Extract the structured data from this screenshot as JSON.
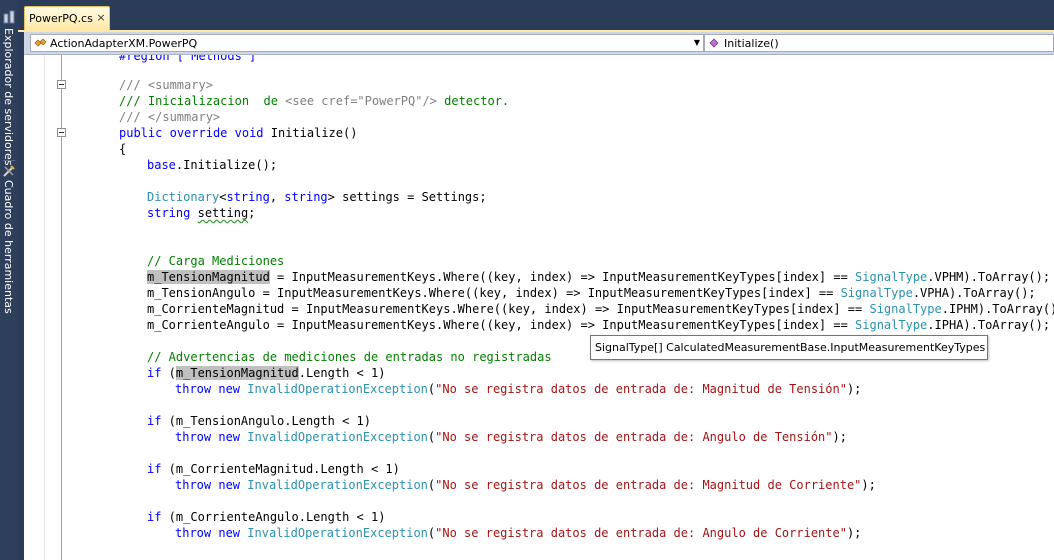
{
  "dock": {
    "items": [
      {
        "label": "Explorador de servidores",
        "icon": "server-explorer-icon"
      },
      {
        "label": "Cuadro de herramientas",
        "icon": "toolbox-icon"
      }
    ]
  },
  "tab": {
    "label": "PowerPQ.cs",
    "close": "×"
  },
  "navbar": {
    "class_combo": {
      "text": "ActionAdapterXM.PowerPQ",
      "icon": "class-icon",
      "arrow": "▼"
    },
    "member_combo": {
      "text": "Initialize()",
      "icon": "method-icon",
      "arrow": "▼"
    }
  },
  "code": {
    "partial_top": "#region [ Methods ]",
    "summary_open": "/// <summary>",
    "summary_doc_a": "/// Inicializacion  de ",
    "summary_doc_see": "<see cref=\"PowerPQ\"/>",
    "summary_doc_b": " detector.",
    "summary_close": "/// </summary>",
    "sig_public": "public",
    "sig_override": "override",
    "sig_void": "void",
    "sig_name": " Initialize()",
    "brace_open": "{",
    "base_kw": "base",
    "base_call": ".Initialize();",
    "dict_type": "Dictionary",
    "dict_lt": "<",
    "dict_string1": "string",
    "dict_comma": ", ",
    "dict_string2": "string",
    "dict_rest": "> settings = Settings;",
    "setting_kw": "string",
    "setting_var": "setting",
    "setting_semi": ";",
    "comment_carga": "// Carga Mediciones",
    "l1_var": "m_TensionMagnitud",
    "l1_mid": " = InputMeasurementKeys.Where((key, index) => InputMeasurementKeyTypes[index] == ",
    "l1_type": "SignalType",
    "l1_end": ".VPHM).ToArray();",
    "l2_var": "m_TensionAngulo",
    "l2_mid": " = InputMeasurementKeys.Where((key, index) => InputMeasurementKeyTypes[index] == ",
    "l2_type": "SignalType",
    "l2_end": ".VPHA).ToArray();",
    "l3_var": "m_CorrienteMagnitud",
    "l3_mid": " = InputMeasurementKeys.Where((key, index) => InputMeasurementKeyTypes[index] == ",
    "l3_type": "SignalType",
    "l3_end": ".IPHM).ToArray();",
    "l4_var": "m_CorrienteAngulo",
    "l4_mid": " = InputMeasurementKeys.Where((key, index) => InputMeasurementKeyTypes[index] == ",
    "l4_type": "SignalType",
    "l4_end": ".IPHA).ToArray();",
    "comment_adv": "// Advertencias de mediciones de entradas no registradas",
    "if_kw": "if",
    "throw_kw": "throw",
    "new_kw": "new",
    "exc_type": "InvalidOperationException",
    "if1_pre": " (",
    "if1_var": "m_TensionMagnitud",
    "if1_end": ".Length < 1)",
    "msg1": "\"No se registra datos de entrada de: Magnitud de Tensión\"",
    "if2_rest": " (m_TensionAngulo.Length < 1)",
    "msg2": "\"No se registra datos de entrada de: Angulo de Tensión\"",
    "if3_rest": " (m_CorrienteMagnitud.Length < 1)",
    "msg3": "\"No se registra datos de entrada de: Magnitud de Corriente\"",
    "if4_rest": " (m_CorrienteAngulo.Length < 1)",
    "msg4": "\"No se registra datos de entrada de: Angulo de Corriente\"",
    "throw_open": "(",
    "throw_close": ");"
  },
  "tooltip": {
    "text": "SignalType[] CalculatedMeasurementBase.InputMeasurementKeyTypes"
  },
  "colors": {
    "keyword": "#0000ff",
    "type": "#2b91af",
    "comment": "#008000",
    "string": "#a31515",
    "tab_active": "#ffe8a6",
    "chrome": "#2b3c59"
  }
}
